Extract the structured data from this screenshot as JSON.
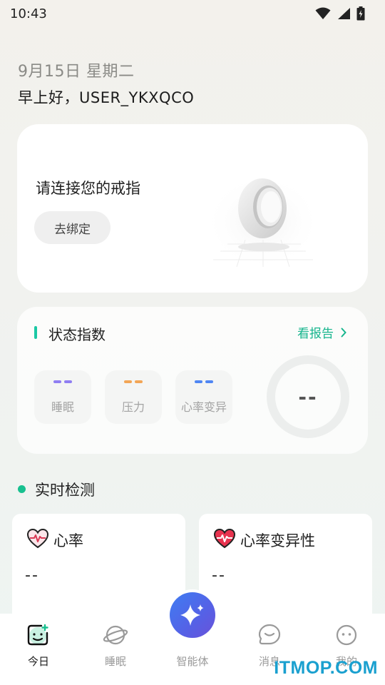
{
  "status_bar": {
    "time": "10:43"
  },
  "header": {
    "date": "9月15日 星期二",
    "greeting": "早上好，USER_YKXQCO"
  },
  "ring_card": {
    "title": "请连接您的戒指",
    "bind_label": "去绑定"
  },
  "status_card": {
    "title": "状态指数",
    "report_label": "看报告",
    "metrics": [
      {
        "label": "睡眠",
        "color": "#8f7ef2"
      },
      {
        "label": "压力",
        "color": "#f2a555"
      },
      {
        "label": "心率变异",
        "color": "#4f86f3"
      }
    ],
    "score": "--"
  },
  "realtime": {
    "title": "实时检测",
    "cards": [
      {
        "title": "心率",
        "value": "--",
        "icon": "heart-outline-icon"
      },
      {
        "title": "心率变异性",
        "value": "--",
        "icon": "heart-red-icon"
      }
    ]
  },
  "tabs": [
    {
      "label": "今日",
      "icon": "today-icon",
      "active": true
    },
    {
      "label": "睡眠",
      "icon": "planet-icon"
    },
    {
      "label": "智能体",
      "icon": "sparkle-icon"
    },
    {
      "label": "消息",
      "icon": "chat-icon"
    },
    {
      "label": "我的",
      "icon": "profile-icon"
    }
  ],
  "colors": {
    "accent": "#18c08f",
    "link": "#17b58d",
    "watermark": "#1aa0cf"
  },
  "watermark": "ITMOP.COM"
}
